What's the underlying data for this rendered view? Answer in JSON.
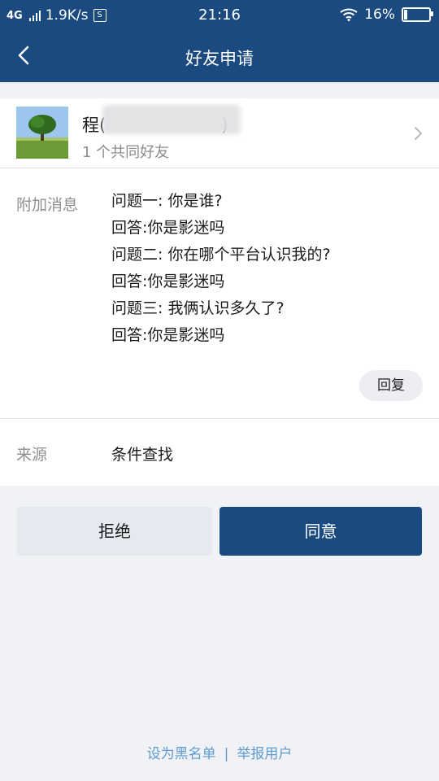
{
  "status_bar": {
    "network": "4G",
    "speed": "1.9K/s",
    "s_icon": "S",
    "time": "21:16",
    "battery": "16%",
    "battery_fraction": 0.16,
    "icons": [
      "signal-bars-icon",
      "s-app-icon",
      "wifi-icon",
      "battery-icon"
    ]
  },
  "navbar": {
    "title": "好友申请",
    "back_icon": "chevron-left-icon"
  },
  "friend": {
    "name": "程(",
    "name_tail": ")",
    "mutual_friends": "1 个共同好友",
    "avatar_icon": "tree-landscape-avatar",
    "chevron_icon": "chevron-right-icon"
  },
  "message": {
    "label": "附加消息",
    "lines": [
      "问题一: 你是谁?",
      "回答:你是影迷吗",
      "问题二: 你在哪个平台认识我的?",
      "回答:你是影迷吗",
      "问题三: 我俩认识多久了?",
      "回答:你是影迷吗"
    ],
    "reply_button": "回复"
  },
  "source": {
    "label": "来源",
    "value": "条件查找"
  },
  "actions": {
    "reject": "拒绝",
    "accept": "同意"
  },
  "footer": {
    "blacklist": "设为黑名单",
    "separator": "|",
    "report": "举报用户"
  },
  "colors": {
    "primary": "#1b4a80",
    "background": "#f1f2f6",
    "link": "#5e9bd0",
    "muted_text": "#8f8f8f"
  }
}
